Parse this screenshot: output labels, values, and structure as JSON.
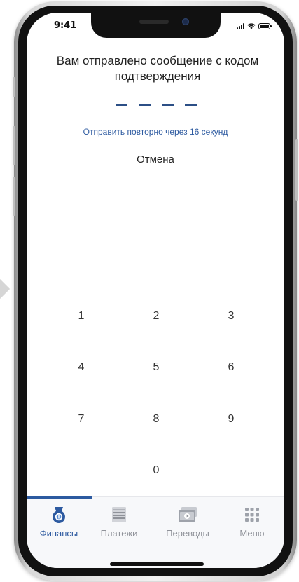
{
  "status_bar": {
    "time": "9:41"
  },
  "verification": {
    "message": "Вам отправлено сообщение с кодом подтверждения",
    "code_length": 4,
    "resend_text": "Отправить повторно через 16 секунд",
    "cancel_label": "Отмена"
  },
  "keypad": {
    "keys": [
      "1",
      "2",
      "3",
      "4",
      "5",
      "6",
      "7",
      "8",
      "9",
      "0"
    ]
  },
  "tabbar": {
    "items": [
      {
        "label": "Финансы",
        "icon": "finance-icon",
        "active": true
      },
      {
        "label": "Платежи",
        "icon": "payments-icon",
        "active": false
      },
      {
        "label": "Переводы",
        "icon": "transfers-icon",
        "active": false
      },
      {
        "label": "Меню",
        "icon": "menu-grid-icon",
        "active": false
      }
    ]
  },
  "colors": {
    "accent": "#2d5aa0",
    "tab_inactive": "#8f9299",
    "dash": "#2c4f86"
  }
}
